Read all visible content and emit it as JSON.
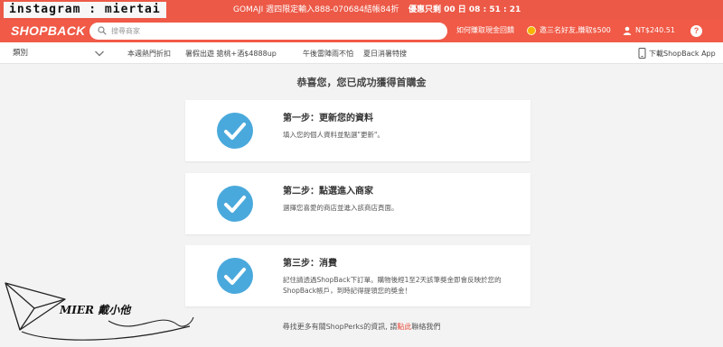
{
  "promo_bar": {
    "watermark": "instagram : miertai",
    "promo_text": "GOMAJI 週四限定輸入888-070684結帳84折",
    "timer_text": "優惠只剩 00 日 08 : 51 : 21"
  },
  "header": {
    "logo": "SHOPBACK",
    "search_placeholder": "搜尋商家",
    "earn_link": "如何賺取現金回饋",
    "invite_link": "邀三名好友,賺取$500",
    "balance": "NT$240.51",
    "help_label": "?"
  },
  "category_bar": {
    "category_label": "類別",
    "items": [
      "本週熱門折扣",
      "暑假出遊 搶桃+酒$4888up",
      "午後雷陣雨不怕",
      "夏日消暑特搜"
    ],
    "download_link": "下載ShopBack App"
  },
  "main": {
    "title": "恭喜您，您已成功獲得首購金",
    "steps": [
      {
        "title": "第一步：更新您的資料",
        "desc": "填入您的個人資料並點選\"更新\"。"
      },
      {
        "title": "第二步：點選進入商家",
        "desc": "選擇您喜愛的商店並進入該商店頁面。"
      },
      {
        "title": "第三步：消費",
        "desc": "記住請透過ShopBack下訂單。購物後經1至2天該筆獎金即會反映於您的ShopBack帳戶，到時記得提領您的獎金！"
      }
    ],
    "footer_before": "尋找更多有關ShopPerks的資訊, 請",
    "footer_link": "點此",
    "footer_after": "聯絡我們"
  },
  "signature": {
    "text": "MIER 戴小他"
  },
  "colors": {
    "brand_red": "#f05a47",
    "check_blue": "#4aa9dc"
  },
  "icons": [
    "search-icon",
    "coin-icon",
    "user-icon",
    "help-icon",
    "chevron-down-icon",
    "mobile-icon",
    "check-icon"
  ]
}
